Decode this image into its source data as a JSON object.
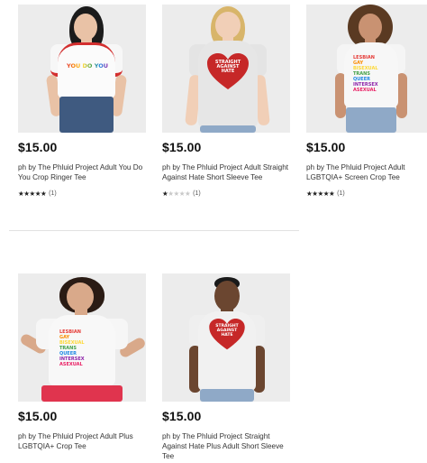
{
  "products": [
    {
      "price": "$15.00",
      "title": "ph by The Phluid Project Adult You Do You Crop Ringer Tee",
      "rating": 5,
      "rating_count": "(1)",
      "graphic_text": "YOU DO YOU"
    },
    {
      "price": "$15.00",
      "title": "ph by The Phluid Project Adult Straight Against Hate Short Sleeve Tee",
      "rating": 1,
      "rating_count": "(1)",
      "graphic_text": "STRAIGHT AGAINST HATE"
    },
    {
      "price": "$15.00",
      "title": "ph by The Phluid Project Adult LGBTQIA+ Screen Crop Tee",
      "rating": 5,
      "rating_count": "(1)",
      "graphic_lines": [
        "LESBIAN",
        "GAY",
        "BISEXUAL",
        "TRANS",
        "QUEER",
        "INTERSEX",
        "ASEXUAL"
      ]
    },
    {
      "price": "$15.00",
      "title": "ph by The Phluid Project Adult Plus LGBTQIA+ Crop Tee",
      "graphic_lines": [
        "LESBIAN",
        "GAY",
        "BISEXUAL",
        "TRANS",
        "QUEER",
        "INTERSEX",
        "ASEXUAL"
      ]
    },
    {
      "price": "$15.00",
      "title": "ph by The Phluid Project Straight Against Hate Plus Adult Short Sleeve Tee",
      "graphic_text": "STRAIGHT AGAINST HATE"
    }
  ],
  "colors": {
    "rainbow": [
      "#e53935",
      "#fb8c00",
      "#fdd835",
      "#43a047",
      "#1e88e5",
      "#8e24aa",
      "#e91e63"
    ],
    "heart": "#c62828",
    "ringer_trim": "#d32f2f",
    "jeans": "#3f5a80",
    "light_jeans": "#8fa9c7",
    "skirt": "#e0344e"
  }
}
